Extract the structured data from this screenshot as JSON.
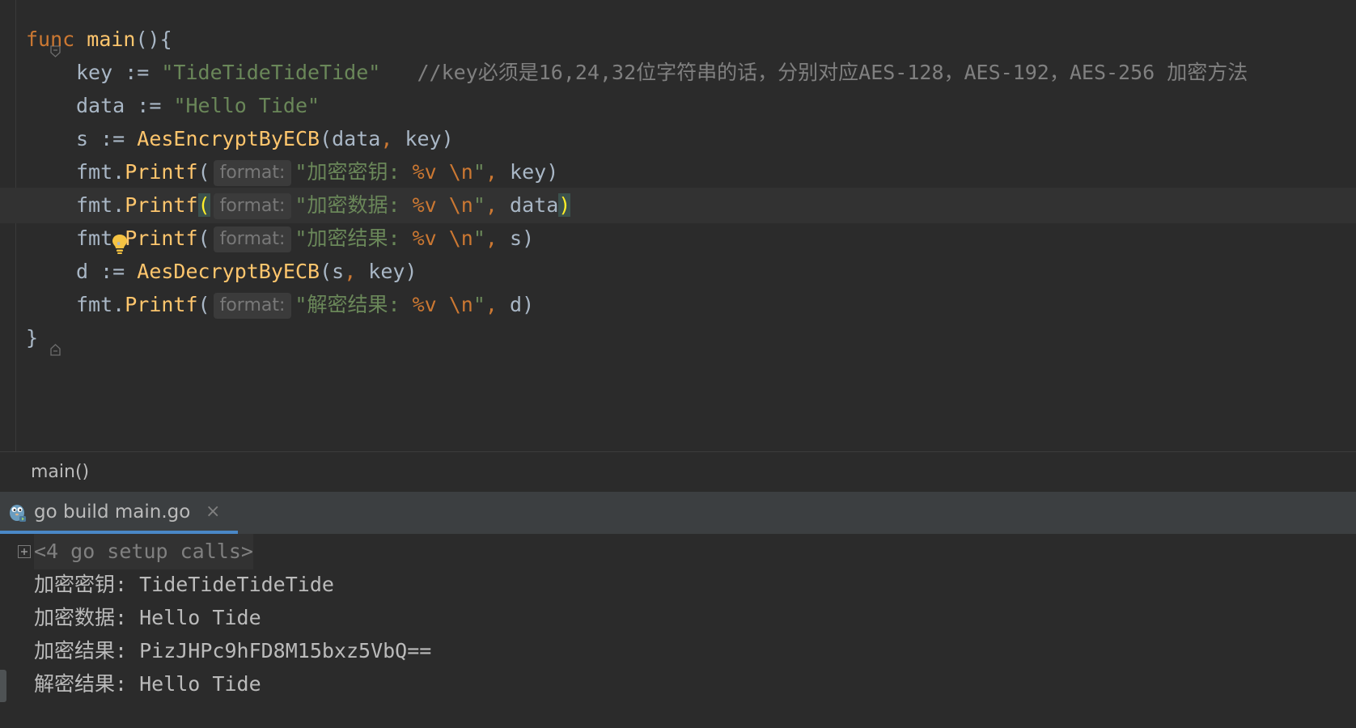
{
  "editor": {
    "lines": [
      {
        "keyword": "func",
        "name": "main",
        "rest": "(){"
      },
      {
        "var": "key",
        "op": " := ",
        "str": "\"TideTideTideTide\"",
        "gap": "   ",
        "comment": "//key必须是16,24,32位字符串的话，分别对应AES-128，AES-192，AES-256 加密方法"
      },
      {
        "var": "data",
        "op": " := ",
        "str": "\"Hello Tide\""
      },
      {
        "var": "s",
        "op": " := ",
        "call": "AesEncryptByECB",
        "open": "(",
        "arg1": "data",
        "comma": ",",
        "arg2": " key",
        "close": ")"
      },
      {
        "pkg": "fmt.",
        "call": "Printf",
        "open": "(",
        "hint": "format:",
        "str_open": "\"加密密钥: ",
        "verb": "%v",
        "space": " ",
        "esc": "\\n",
        "str_close": "\"",
        "comma": ",",
        "arg": " key",
        "close": ")"
      },
      {
        "pkg": "fmt.",
        "call": "Printf",
        "open": "(",
        "hint": "format:",
        "str_open": "\"加密数据: ",
        "verb": "%v",
        "space": " ",
        "esc": "\\n",
        "str_close": "\"",
        "comma": ",",
        "arg": " data",
        "close": ")"
      },
      {
        "pkg": "fmt.",
        "call": "Printf",
        "open": "(",
        "hint": "format:",
        "str_open": "\"加密结果: ",
        "verb": "%v",
        "space": " ",
        "esc": "\\n",
        "str_close": "\"",
        "comma": ",",
        "arg": " s",
        "close": ")"
      },
      {
        "var": "d",
        "op": " := ",
        "call": "AesDecryptByECB",
        "open": "(",
        "arg1": "s",
        "comma": ",",
        "arg2": " key",
        "close": ")"
      },
      {
        "pkg": "fmt.",
        "call": "Printf",
        "open": "(",
        "hint": "format:",
        "str_open": "\"解密结果: ",
        "verb": "%v",
        "space": " ",
        "esc": "\\n",
        "str_close": "\"",
        "comma": ",",
        "arg": " d",
        "close": ")"
      },
      {
        "brace": "}"
      }
    ]
  },
  "breadcrumb": {
    "text": "main()"
  },
  "run": {
    "tab_label": "go build main.go",
    "close_glyph": "×",
    "setup_calls": "<4 go setup calls>",
    "output": [
      "加密密钥: TideTideTideTide",
      "加密数据: Hello Tide",
      "加密结果: PizJHPc9hFD8M15bxz5VbQ==",
      "解密结果: Hello Tide"
    ]
  },
  "colors": {
    "background": "#2b2b2b",
    "keyword": "#cc7832",
    "function": "#ffc66d",
    "string": "#6a8759",
    "comment": "#808080",
    "text": "#a9b7c6",
    "tab_underline": "#4a88c7"
  },
  "icons": {
    "fold_marker": "fold-icon",
    "intention_bulb": "lightbulb-icon",
    "run_tab": "gopher-icon",
    "expand": "expand-plus-icon"
  }
}
